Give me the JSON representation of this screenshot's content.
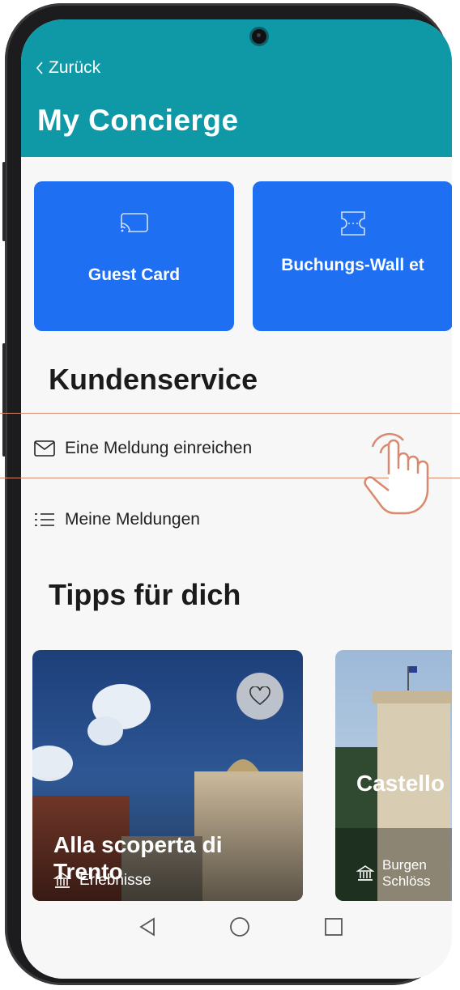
{
  "header": {
    "back_label": "Zurück",
    "title": "My Concierge",
    "color": "#0f98a5"
  },
  "tiles": [
    {
      "label": "Guest Card",
      "icon": "cast-card-icon"
    },
    {
      "label": "Buchungs-Wall et",
      "icon": "ticket-icon"
    }
  ],
  "customer_service": {
    "heading": "Kundenservice",
    "items": [
      {
        "label": "Eine Meldung einreichen",
        "icon": "mail-icon"
      },
      {
        "label": "Meine Meldungen",
        "icon": "list-icon"
      }
    ]
  },
  "tips": {
    "heading": "Tipps für dich",
    "cards": [
      {
        "title": "Alla scoperta di Trento",
        "category": "Erlebnisse",
        "icon": "museum-icon"
      },
      {
        "title": "Castello Buoncon - Schloss",
        "category": "Burgen Schlöss",
        "icon": "museum-icon"
      }
    ]
  },
  "colors": {
    "accent": "#1f6ff2",
    "teal": "#0f98a5"
  }
}
